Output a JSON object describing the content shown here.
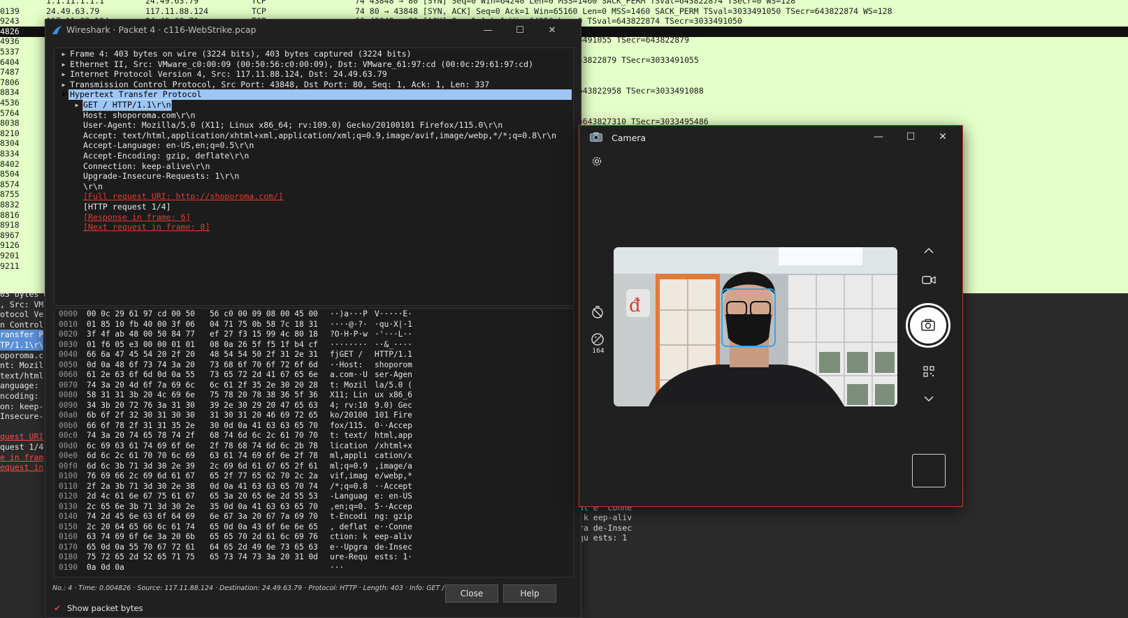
{
  "background_list": {
    "rows": [
      {
        "no": "",
        "time": "1.1.11.1.1.1",
        "src": "24.49.63.79",
        "proto": "TCP",
        "info": "74 43848 → 80 [SYN] Seq=0 Win=64240 Len=0 MSS=1460 SACK_PERM TSval=643822874 TSecr=0 WS=128",
        "selected": false
      },
      {
        "no": "0139",
        "time": "24.49.63.79",
        "src": "117.11.88.124",
        "proto": "TCP",
        "info": "74 80 → 43848 [SYN, ACK] Seq=0 Ack=1 Win=65160 Len=0 MSS=1460 SACK_PERM TSval=3033491050 TSecr=643822874 WS=128",
        "selected": false
      },
      {
        "no": "9243",
        "time": "117.11.88.124",
        "src": "24.49.63.79",
        "proto": "TCP",
        "info": "66 43848 → 80 [ACK] Seq=1 Ack=1 Win=64256 Len=0 TSval=643822874 TSecr=3033491050",
        "selected": false
      },
      {
        "no": "4826",
        "time": "",
        "src": "",
        "proto": "",
        "info": "",
        "selected": true
      },
      {
        "no": "4936",
        "time": "",
        "src": "",
        "proto": "",
        "info": "",
        "selected": false
      },
      {
        "no": "5337",
        "time": "",
        "src": "",
        "proto": "",
        "info": "",
        "selected": false
      },
      {
        "no": "6404",
        "time": "",
        "src": "",
        "proto": "",
        "info": "",
        "selected": false
      },
      {
        "no": "7487",
        "time": "",
        "src": "",
        "proto": "",
        "info": "",
        "selected": false
      },
      {
        "no": "7806",
        "time": "",
        "src": "",
        "proto": "",
        "info": "",
        "selected": false
      },
      {
        "no": "8834",
        "time": "",
        "src": "",
        "proto": "",
        "info": "",
        "selected": false
      },
      {
        "no": "4536",
        "time": "",
        "src": "",
        "proto": "",
        "info": "",
        "selected": false
      },
      {
        "no": "5764",
        "time": "",
        "src": "",
        "proto": "",
        "info": "",
        "selected": false
      },
      {
        "no": "8038",
        "time": "",
        "src": "",
        "proto": "",
        "info": "",
        "selected": false
      },
      {
        "no": "8210",
        "time": "",
        "src": "",
        "proto": "",
        "info": "",
        "selected": false
      },
      {
        "no": "8304",
        "time": "",
        "src": "",
        "proto": "",
        "info": "",
        "selected": false
      },
      {
        "no": "8334",
        "time": "",
        "src": "",
        "proto": "",
        "info": "",
        "selected": false
      },
      {
        "no": "8402",
        "time": "",
        "src": "",
        "proto": "",
        "info": "",
        "selected": false
      },
      {
        "no": "8504",
        "time": "",
        "src": "",
        "proto": "",
        "info": "",
        "selected": false
      },
      {
        "no": "8574",
        "time": "",
        "src": "",
        "proto": "",
        "info": "",
        "selected": false
      },
      {
        "no": "8755",
        "time": "",
        "src": "",
        "proto": "",
        "info": "",
        "selected": false
      },
      {
        "no": "8832",
        "time": "",
        "src": "",
        "proto": "",
        "info": "",
        "selected": false
      },
      {
        "no": "8816",
        "time": "",
        "src": "",
        "proto": "",
        "info": "",
        "selected": false
      },
      {
        "no": "8918",
        "time": "",
        "src": "",
        "proto": "",
        "info": "",
        "selected": false
      },
      {
        "no": "8967",
        "time": "",
        "src": "",
        "proto": "",
        "info": "",
        "selected": false
      },
      {
        "no": "9126",
        "time": "",
        "src": "",
        "proto": "",
        "info": "",
        "selected": false
      },
      {
        "no": "9201",
        "time": "",
        "src": "",
        "proto": "",
        "info": "",
        "selected": false
      },
      {
        "no": "9211",
        "time": "",
        "src": "",
        "proto": "",
        "info": "",
        "selected": false
      }
    ],
    "right_fragments": [
      "3033491055 TSecr=643822879",
      "l=643822879 TSecr=3033491055",
      "al=643822958 TSecr=3033491088",
      "val=643827310 TSecr=3033495486"
    ]
  },
  "background_details": {
    "lines": [
      "03 bytes o",
      ", Src: VM",
      "otocol Ve",
      "n Control",
      "ransfer P",
      "TP/1.1\\r\\",
      "oporoma.c",
      "nt: Mozil",
      "text/html",
      "anguage: ",
      "ncoding: ",
      "on: keep-",
      "Insecure-",
      "",
      "quest URI",
      "quest 1/4",
      "e in fram",
      "equest in"
    ],
    "hex_fragments": [
      "di ng: gzip",
      "at e  Conne",
      " k eep-aliv",
      "ra de-Insec",
      "qu ests: 1 "
    ]
  },
  "wireshark": {
    "title": "Wireshark · Packet 4 · c116-WebStrike.pcap",
    "tree": [
      {
        "text": "Frame 4: 403 bytes on wire (3224 bits), 403 bytes captured (3224 bits)",
        "depth": 0,
        "arrow": "right",
        "style": "normal"
      },
      {
        "text": "Ethernet II, Src: VMware_c0:00:09 (00:50:56:c0:00:09), Dst: VMware_61:97:cd (00:0c:29:61:97:cd)",
        "depth": 0,
        "arrow": "right",
        "style": "normal"
      },
      {
        "text": "Internet Protocol Version 4, Src: 117.11.88.124, Dst: 24.49.63.79",
        "depth": 0,
        "arrow": "right",
        "style": "normal"
      },
      {
        "text": "Transmission Control Protocol, Src Port: 43848, Dst Port: 80, Seq: 1, Ack: 1, Len: 337",
        "depth": 0,
        "arrow": "right",
        "style": "normal"
      },
      {
        "text": "Hypertext Transfer Protocol",
        "depth": 0,
        "arrow": "down",
        "style": "highlight"
      },
      {
        "text": "GET / HTTP/1.1\\r\\n",
        "depth": 1,
        "arrow": "right",
        "style": "boxed"
      },
      {
        "text": "Host: shoporoma.com\\r\\n",
        "depth": 1,
        "arrow": "",
        "style": "normal"
      },
      {
        "text": "User-Agent: Mozilla/5.0 (X11; Linux x86_64; rv:109.0) Gecko/20100101 Firefox/115.0\\r\\n",
        "depth": 1,
        "arrow": "",
        "style": "normal"
      },
      {
        "text": "Accept: text/html,application/xhtml+xml,application/xml;q=0.9,image/avif,image/webp,*/*;q=0.8\\r\\n",
        "depth": 1,
        "arrow": "",
        "style": "normal"
      },
      {
        "text": "Accept-Language: en-US,en;q=0.5\\r\\n",
        "depth": 1,
        "arrow": "",
        "style": "normal"
      },
      {
        "text": "Accept-Encoding: gzip, deflate\\r\\n",
        "depth": 1,
        "arrow": "",
        "style": "normal"
      },
      {
        "text": "Connection: keep-alive\\r\\n",
        "depth": 1,
        "arrow": "",
        "style": "normal"
      },
      {
        "text": "Upgrade-Insecure-Requests: 1\\r\\n",
        "depth": 1,
        "arrow": "",
        "style": "normal"
      },
      {
        "text": "\\r\\n",
        "depth": 1,
        "arrow": "",
        "style": "normal"
      },
      {
        "text": "[Full request URI: http://shoporoma.com/]",
        "depth": 1,
        "arrow": "",
        "style": "link"
      },
      {
        "text": "[HTTP request 1/4]",
        "depth": 1,
        "arrow": "",
        "style": "normal"
      },
      {
        "text": "[Response in frame: 6]",
        "depth": 1,
        "arrow": "",
        "style": "link"
      },
      {
        "text": "[Next request in frame: 8]",
        "depth": 1,
        "arrow": "",
        "style": "link"
      }
    ],
    "splitter": "......",
    "hex": [
      {
        "off": "0000",
        "b1": "00 0c 29 61 97 cd 00 50",
        "b2": "56 c0 00 09 08 00 45 00",
        "a1": "··)a···P",
        "a2": "V·····E·"
      },
      {
        "off": "0010",
        "b1": "01 85 10 fb 40 00 3f 06",
        "b2": "04 71 75 0b 58 7c 18 31",
        "a1": "····@·?·",
        "a2": "·qu·X|·1"
      },
      {
        "off": "0020",
        "b1": "3f 4f ab 48 00 50 84 77",
        "b2": "ef 27 f3 15 99 4c 80 18",
        "a1": "?O·H·P·w",
        "a2": "·'···L··"
      },
      {
        "off": "0030",
        "b1": "01 f6 05 e3 00 00 01 01",
        "b2": "08 0a 26 5f f5 1f b4 cf",
        "a1": "········",
        "a2": "··&_····"
      },
      {
        "off": "0040",
        "b1": "66 6a 47 45 54 20 2f 20",
        "b2": "48 54 54 50 2f 31 2e 31",
        "a1": "fjGET / ",
        "a2": "HTTP/1.1"
      },
      {
        "off": "0050",
        "b1": "0d 0a 48 6f 73 74 3a 20",
        "b2": "73 68 6f 70 6f 72 6f 6d",
        "a1": "··Host: ",
        "a2": "shoporom"
      },
      {
        "off": "0060",
        "b1": "61 2e 63 6f 6d 0d 0a 55",
        "b2": "73 65 72 2d 41 67 65 6e",
        "a1": "a.com··U",
        "a2": "ser-Agen"
      },
      {
        "off": "0070",
        "b1": "74 3a 20 4d 6f 7a 69 6c",
        "b2": "6c 61 2f 35 2e 30 20 28",
        "a1": "t: Mozil",
        "a2": "la/5.0 ("
      },
      {
        "off": "0080",
        "b1": "58 31 31 3b 20 4c 69 6e",
        "b2": "75 78 20 78 38 36 5f 36",
        "a1": "X11; Lin",
        "a2": "ux x86_6"
      },
      {
        "off": "0090",
        "b1": "34 3b 20 72 76 3a 31 30",
        "b2": "39 2e 30 29 20 47 65 63",
        "a1": "4; rv:10",
        "a2": "9.0) Gec"
      },
      {
        "off": "00a0",
        "b1": "6b 6f 2f 32 30 31 30 30",
        "b2": "31 30 31 20 46 69 72 65",
        "a1": "ko/20100",
        "a2": "101 Fire"
      },
      {
        "off": "00b0",
        "b1": "66 6f 78 2f 31 31 35 2e",
        "b2": "30 0d 0a 41 63 63 65 70",
        "a1": "fox/115.",
        "a2": "0··Accep"
      },
      {
        "off": "00c0",
        "b1": "74 3a 20 74 65 78 74 2f",
        "b2": "68 74 6d 6c 2c 61 70 70",
        "a1": "t: text/",
        "a2": "html,app"
      },
      {
        "off": "00d0",
        "b1": "6c 69 63 61 74 69 6f 6e",
        "b2": "2f 78 68 74 6d 6c 2b 78",
        "a1": "lication",
        "a2": "/xhtml+x"
      },
      {
        "off": "00e0",
        "b1": "6d 6c 2c 61 70 70 6c 69",
        "b2": "63 61 74 69 6f 6e 2f 78",
        "a1": "ml,appli",
        "a2": "cation/x"
      },
      {
        "off": "00f0",
        "b1": "6d 6c 3b 71 3d 30 2e 39",
        "b2": "2c 69 6d 61 67 65 2f 61",
        "a1": "ml;q=0.9",
        "a2": ",image/a"
      },
      {
        "off": "0100",
        "b1": "76 69 66 2c 69 6d 61 67",
        "b2": "65 2f 77 65 62 70 2c 2a",
        "a1": "vif,imag",
        "a2": "e/webp,*"
      },
      {
        "off": "0110",
        "b1": "2f 2a 3b 71 3d 30 2e 38",
        "b2": "0d 0a 41 63 63 65 70 74",
        "a1": "/*;q=0.8",
        "a2": "··Accept"
      },
      {
        "off": "0120",
        "b1": "2d 4c 61 6e 67 75 61 67",
        "b2": "65 3a 20 65 6e 2d 55 53",
        "a1": "-Languag",
        "a2": "e: en-US"
      },
      {
        "off": "0130",
        "b1": "2c 65 6e 3b 71 3d 30 2e",
        "b2": "35 0d 0a 41 63 63 65 70",
        "a1": ",en;q=0.",
        "a2": "5··Accep"
      },
      {
        "off": "0140",
        "b1": "74 2d 45 6e 63 6f 64 69",
        "b2": "6e 67 3a 20 67 7a 69 70",
        "a1": "t-Encodi",
        "a2": "ng: gzip"
      },
      {
        "off": "0150",
        "b1": "2c 20 64 65 66 6c 61 74",
        "b2": "65 0d 0a 43 6f 6e 6e 65",
        "a1": ", deflat",
        "a2": "e··Conne"
      },
      {
        "off": "0160",
        "b1": "63 74 69 6f 6e 3a 20 6b",
        "b2": "65 65 70 2d 61 6c 69 76",
        "a1": "ction: k",
        "a2": "eep-aliv"
      },
      {
        "off": "0170",
        "b1": "65 0d 0a 55 70 67 72 61",
        "b2": "64 65 2d 49 6e 73 65 63",
        "a1": "e··Upgra",
        "a2": "de-Insec"
      },
      {
        "off": "0180",
        "b1": "75 72 65 2d 52 65 71 75",
        "b2": "65 73 74 73 3a 20 31 0d",
        "a1": "ure-Requ",
        "a2": "ests: 1·"
      },
      {
        "off": "0190",
        "b1": "0a 0d 0a",
        "b2": "",
        "a1": "···",
        "a2": ""
      }
    ],
    "status": "No.: 4 · Time: 0.004826 · Source: 117.11.88.124 · Destination: 24.49.63.79 · Protocol: HTTP · Length: 403 · Info: GET / HTTP/1.1",
    "show_bytes_label": "Show packet bytes",
    "close_label": "Close",
    "help_label": "Help"
  },
  "camera": {
    "title": "Camera",
    "brightness_value": "164"
  },
  "colors": {
    "list_bg": "#e4ffc7",
    "highlight_blue": "#9cc6f5",
    "link_red": "#e53935",
    "camera_border": "#c23a2a",
    "face_box": "#36a6e8"
  }
}
